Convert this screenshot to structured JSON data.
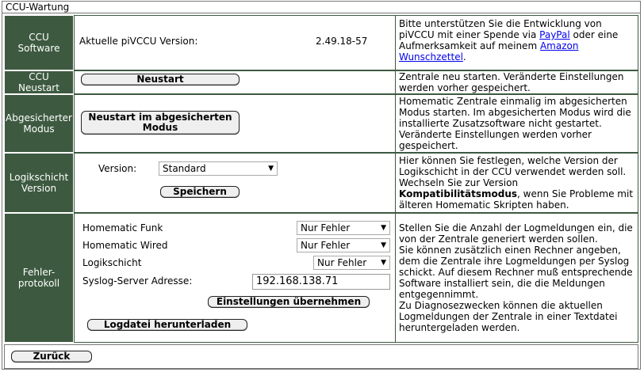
{
  "window": {
    "title": "CCU-Wartung"
  },
  "rows": {
    "software": {
      "label": "CCU\nSoftware",
      "version_label": "Aktuelle piVCCU Version:",
      "version_value": "2.49.18-57",
      "help_pre": "Bitte unterstützen Sie die Entwicklung von piVCCU mit einer Spende via ",
      "help_link1": "PayPal",
      "help_mid": " oder eine Aufmerksamkeit auf meinem ",
      "help_link2": "Amazon Wunschzettel",
      "help_post": "."
    },
    "restart": {
      "label": "CCU\nNeustart",
      "button": "Neustart",
      "help": "Zentrale neu starten. Veränderte Einstellungen werden vorher gespeichert."
    },
    "safemode": {
      "label": "Abgesicherter\nModus",
      "button": "Neustart im abgesicherten Modus",
      "help": "Homematic Zentrale einmalig im abgesicherten Modus starten. Im abgesicherten Modus wird die installierte Zusatzsoftware nicht gestartet. Veränderte Einstellungen werden vorher gespeichert."
    },
    "logiclayer": {
      "label": "Logikschicht\nVersion",
      "version_label": "Version:",
      "version_value": "Standard",
      "save_button": "Speichern",
      "help_pre": "Hier können Sie festlegen, welche Version der Logikschicht in der CCU verwendet werden soll. Wechseln Sie zur Version ",
      "help_bold": "Kompatibilitätsmodus",
      "help_post": ", wenn Sie Probleme mit älteren Homematic Skripten haben."
    },
    "errorlog": {
      "label": "Fehler-\nprotokoll",
      "funk_label": "Homematic Funk",
      "funk_value": "Nur Fehler",
      "wired_label": "Homematic Wired",
      "wired_value": "Nur Fehler",
      "logic_label": "Logikschicht",
      "logic_value": "Nur Fehler",
      "syslog_label": "Syslog-Server Adresse:",
      "syslog_value": "192.168.138.71",
      "apply_button": "Einstellungen übernehmen",
      "download_button": "Logdatei herunterladen",
      "help": "Stellen Sie die Anzahl der Logmeldungen ein, die von der Zentrale generiert werden sollen.\nSie können zusätzlich einen Rechner angeben, dem die Zentrale ihre Logmeldungen per Syslog schickt. Auf diesem Rechner muß entsprechende Software installiert sein, die die Meldungen entgegennimmt.\nZu Diagnosezwecken können die aktuellen Logmeldungen der Zentrale in einer Textdatei heruntergeladen werden."
    }
  },
  "footer": {
    "back_button": "Zurück"
  },
  "icons": {
    "select_arrow": "▼"
  }
}
